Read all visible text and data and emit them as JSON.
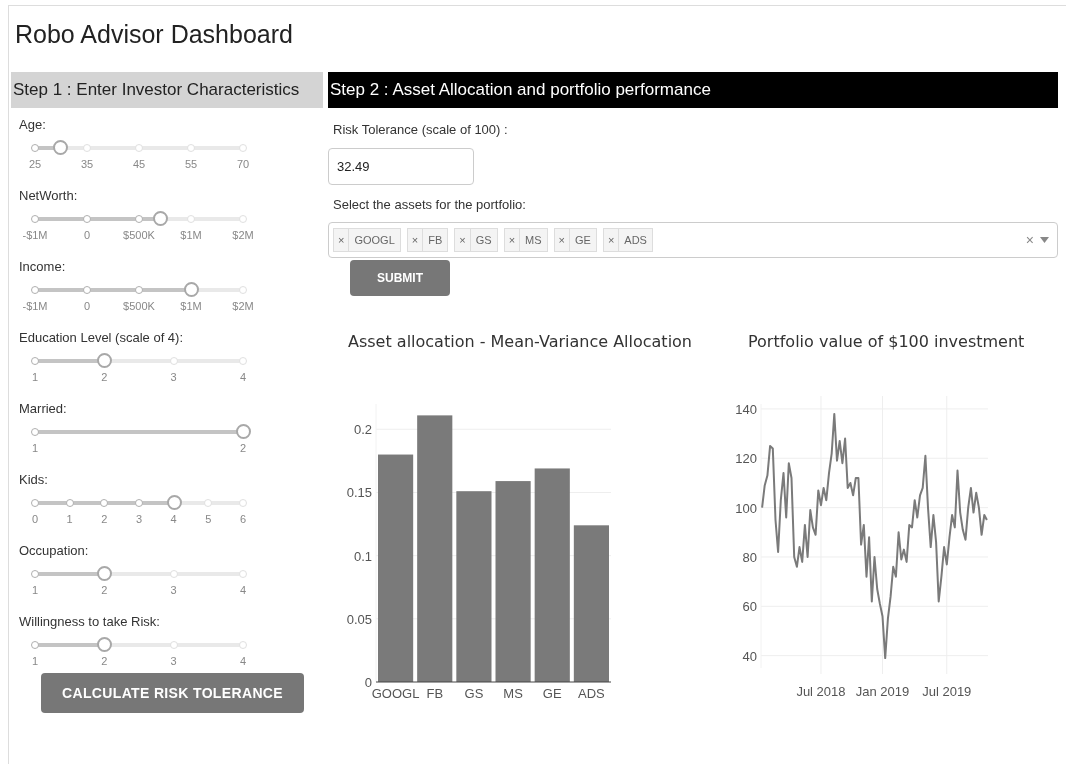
{
  "title": "Robo Advisor Dashboard",
  "step1": {
    "heading": "Step 1 : Enter Investor Characteristics",
    "sliders": [
      {
        "label": "Age:",
        "level": 0.12,
        "marks": [
          "25",
          "35",
          "45",
          "55",
          "70"
        ]
      },
      {
        "label": "NetWorth:",
        "level": 0.6,
        "marks": [
          "-$1M",
          "0",
          "$500K",
          "$1M",
          "$2M"
        ]
      },
      {
        "label": "Income:",
        "level": 0.75,
        "marks": [
          "-$1M",
          "0",
          "$500K",
          "$1M",
          "$2M"
        ]
      },
      {
        "label": "Education Level (scale of 4):",
        "level": 0.3333,
        "marks": [
          "1",
          "2",
          "3",
          "4"
        ]
      },
      {
        "label": "Married:",
        "level": 1,
        "marks": [
          "1",
          "2"
        ]
      },
      {
        "label": "Kids:",
        "level": 0.6667,
        "marks": [
          "0",
          "1",
          "2",
          "3",
          "4",
          "5",
          "6"
        ]
      },
      {
        "label": "Occupation:",
        "level": 0.3333,
        "marks": [
          "1",
          "2",
          "3",
          "4"
        ]
      },
      {
        "label": "Willingness to take Risk:",
        "level": 0.3333,
        "marks": [
          "1",
          "2",
          "3",
          "4"
        ]
      }
    ],
    "button": "CALCULATE RISK TOLERANCE"
  },
  "step2": {
    "heading": "Step 2 : Asset Allocation and portfolio performance",
    "risk_label": "Risk Tolerance (scale of 100) :",
    "risk_value": "32.49",
    "assets_label": "Select the assets for the portfolio:",
    "assets": [
      {
        "remove": "×",
        "label": "GOOGL"
      },
      {
        "remove": "×",
        "label": "FB"
      },
      {
        "remove": "×",
        "label": "GS"
      },
      {
        "remove": "×",
        "label": "MS"
      },
      {
        "remove": "×",
        "label": "GE"
      },
      {
        "remove": "×",
        "label": "ADS"
      }
    ],
    "clear": "×",
    "button": "SUBMIT",
    "allocation_chart": {
      "chart_data": {
        "type": "bar",
        "title": "Asset allocation - Mean-Variance Allocation",
        "categories": [
          "GOOGL",
          "FB",
          "GS",
          "MS",
          "GE",
          "ADS"
        ],
        "values": [
          0.18,
          0.211,
          0.151,
          0.159,
          0.169,
          0.124
        ],
        "grid": true,
        "ylim": [
          0,
          0.22
        ],
        "yticks": [
          {
            "value": 0,
            "label": "0"
          },
          {
            "value": 0.05,
            "label": "0.05"
          },
          {
            "value": 0.1,
            "label": "0.1"
          },
          {
            "value": 0.15,
            "label": "0.15"
          },
          {
            "value": 0.2,
            "label": "0.2"
          }
        ]
      }
    },
    "portfolio_chart": {
      "chart_data": {
        "type": "line",
        "title": "Portfolio value of $100 investment",
        "categories": [
          null,
          null,
          null,
          null,
          null,
          null,
          null,
          null,
          null,
          null,
          null,
          null,
          null,
          null,
          null,
          null,
          null,
          null,
          null,
          null,
          null,
          null,
          "Jul 2018",
          null,
          null,
          null,
          null,
          null,
          null,
          null,
          null,
          null,
          null,
          null,
          null,
          null,
          null,
          null,
          null,
          null,
          null,
          null,
          null,
          null,
          null,
          "Jan 2019",
          null,
          null,
          null,
          null,
          null,
          null,
          null,
          null,
          null,
          null,
          null,
          null,
          null,
          null,
          null,
          null,
          null,
          null,
          null,
          null,
          null,
          null,
          null,
          "Jul 2019",
          null,
          null,
          null,
          null,
          null,
          null,
          null,
          null,
          null,
          null,
          null,
          null,
          null,
          null,
          null
        ],
        "grid": true,
        "series": [
          {
            "color": "#7a7a7a",
            "values": [
              100,
              109,
              113,
              125,
              124,
              95,
              82,
              103,
              114,
              96,
              118,
              112,
              80,
              76,
              84,
              78,
              93,
              80,
              99,
              92,
              89,
              107,
              101,
              108,
              103,
              114,
              122,
              138,
              119,
              127,
              118,
              128,
              108,
              110,
              105,
              112,
              112,
              85,
              93,
              72,
              88,
              62,
              80,
              67,
              61,
              56,
              39,
              55,
              64,
              76,
              72,
              90,
              79,
              83,
              78,
              93,
              92,
              103,
              96,
              105,
              108,
              121,
              100,
              84,
              97,
              86,
              62,
              72,
              84,
              77,
              88,
              97,
              92,
              115,
              98,
              91,
              87,
              100,
              108,
              98,
              106,
              100,
              89,
              97,
              95
            ]
          }
        ],
        "ylim": [
          35,
          142
        ],
        "yticks": [
          40,
          60,
          80,
          100,
          120,
          140
        ]
      }
    }
  }
}
